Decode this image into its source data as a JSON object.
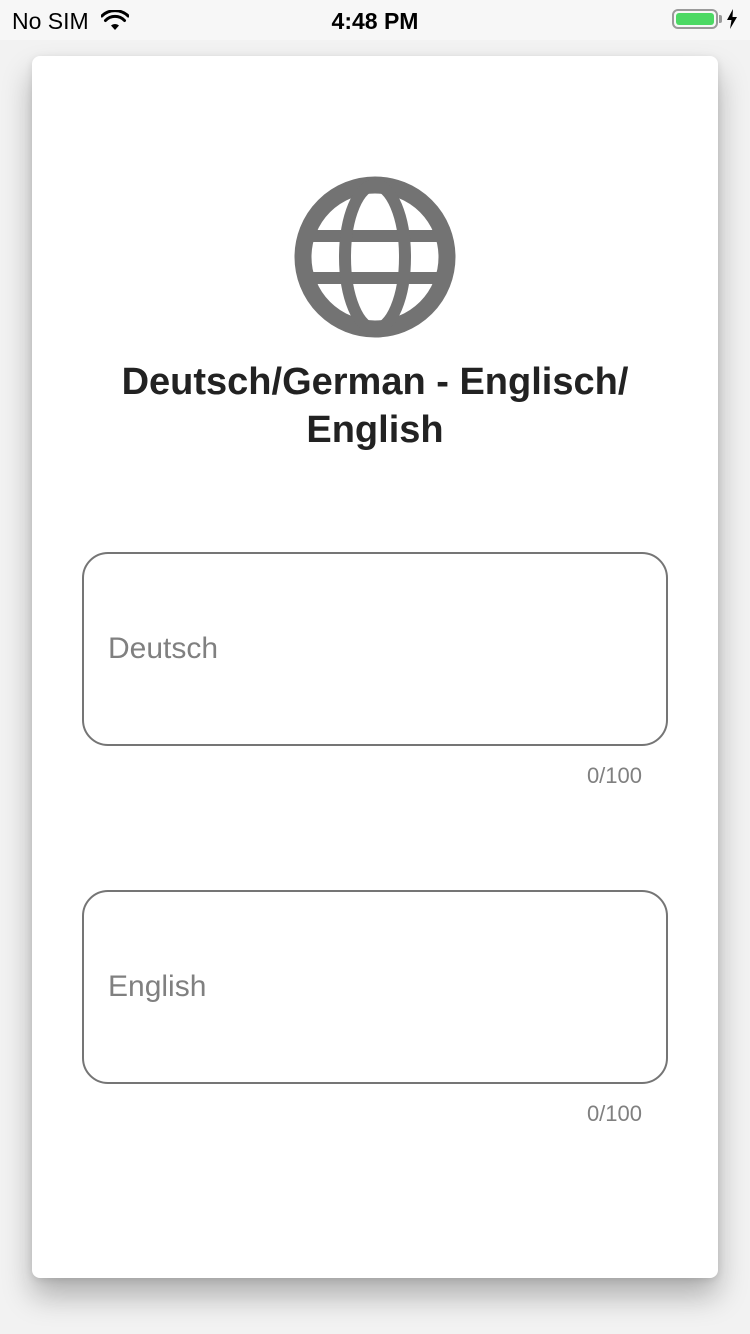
{
  "status_bar": {
    "carrier": "No SIM",
    "time": "4:48 PM",
    "battery_level": 1.0,
    "wifi_icon": "wifi-icon",
    "bolt_icon": "bolt-icon"
  },
  "card": {
    "icon": "globe-icon",
    "title": "Deutsch/German - Englisch/ English",
    "fields": [
      {
        "placeholder": "Deutsch",
        "value": "",
        "counter": "0/100"
      },
      {
        "placeholder": "English",
        "value": "",
        "counter": "0/100"
      }
    ]
  },
  "colors": {
    "icon_gray": "#737373",
    "border_gray": "#757575",
    "battery_green": "#4cd964",
    "title_text": "#222222"
  }
}
